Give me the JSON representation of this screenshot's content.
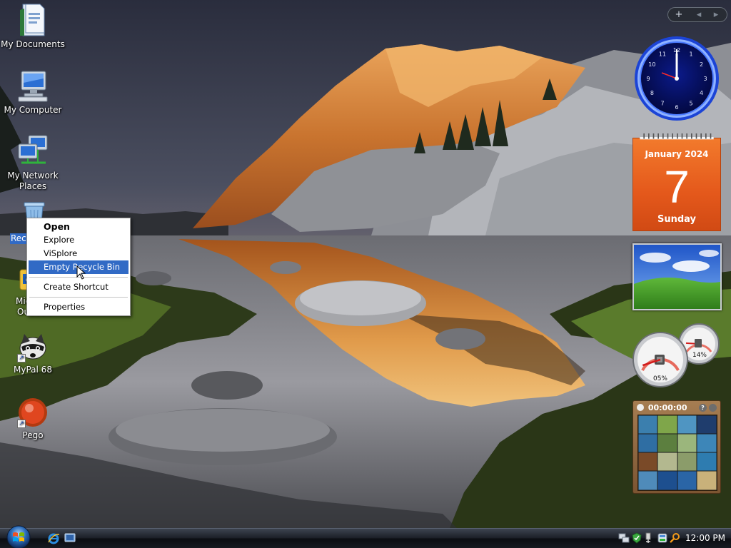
{
  "desktop": {
    "icons": [
      {
        "label": "My Documents"
      },
      {
        "label": "My Computer"
      },
      {
        "label": "My Network Places"
      },
      {
        "label": "Recycle Bin"
      },
      {
        "label": "Microsoft Outlook"
      },
      {
        "label": "MyPal 68"
      },
      {
        "label": "Pego"
      }
    ],
    "network_label_line1": "My Network",
    "network_label_line2": "Places",
    "recycle_visible_label": "Recy",
    "outlook_visible_line1": "Mic",
    "outlook_visible_line2": "Outlook"
  },
  "context_menu": {
    "items": [
      {
        "label": "Open",
        "bold": true
      },
      {
        "label": "Explore"
      },
      {
        "label": "ViSplore"
      },
      {
        "label": "Empty Recycle Bin",
        "highlighted": true
      },
      {
        "label": "Create Shortcut"
      },
      {
        "label": "Properties"
      }
    ]
  },
  "sidebar": {
    "add_label": "+",
    "prev_label": "◂",
    "next_label": "▸"
  },
  "clock_gadget": {
    "time_shown": "12:00",
    "numbers": [
      "12",
      "1",
      "2",
      "3",
      "4",
      "5",
      "6",
      "7",
      "8",
      "9",
      "10",
      "11"
    ]
  },
  "calendar_gadget": {
    "month_year": "January 2024",
    "day": "7",
    "weekday": "Sunday"
  },
  "cpu_meter": {
    "cpu_percent_label": "05%",
    "memory_percent_label": "14%",
    "cpu_percent": 5,
    "memory_percent": 14
  },
  "puzzle_gadget": {
    "timer": "00:00:00"
  },
  "taskbar": {
    "clock": "12:00 PM",
    "quick_launch": [
      "internet-explorer-icon",
      "show-desktop-icon"
    ],
    "tray_icons": [
      "network-icon",
      "security-icon",
      "usb-device-icon",
      "messenger-icon",
      "search-icon"
    ]
  },
  "colors": {
    "selection": "#316ac5",
    "calendar_orange": "#e4581b",
    "clock_blue": "#1a4fff"
  }
}
